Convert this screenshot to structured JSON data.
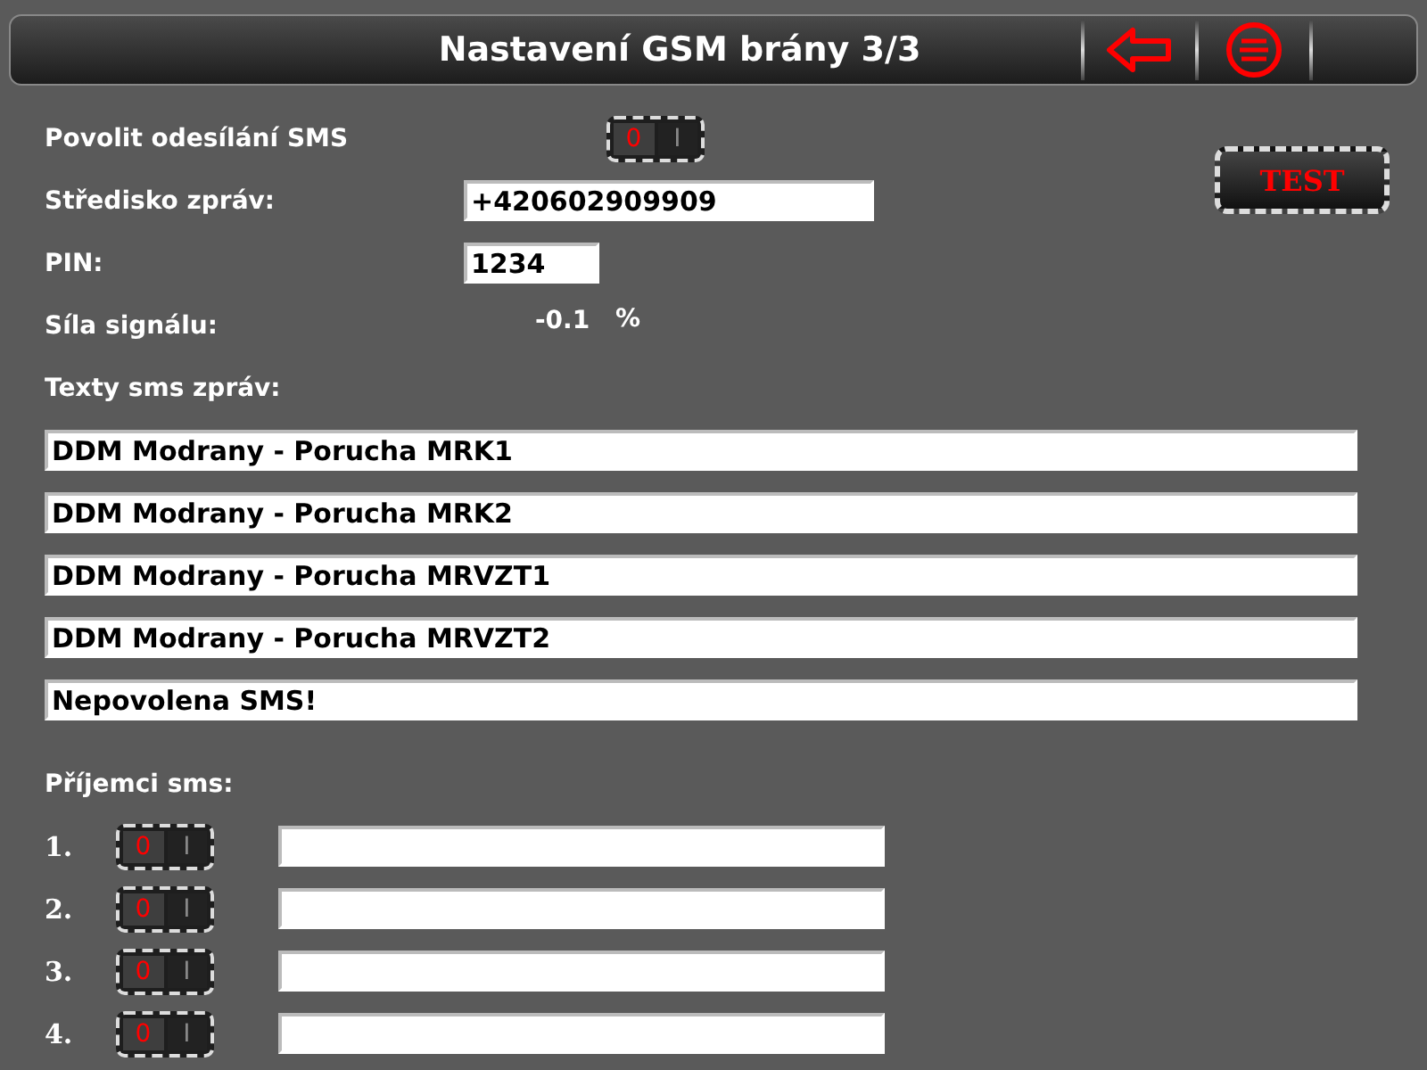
{
  "header": {
    "title": "Nastavení GSM brány 3/3"
  },
  "send_sms": {
    "label": "Povolit odesílání SMS",
    "toggle": {
      "off_label": "0",
      "on_label": "I",
      "on": false
    }
  },
  "test_button": "TEST",
  "message_center": {
    "label": "Středisko zpráv:",
    "value": "+420602909909"
  },
  "pin": {
    "label": "PIN:",
    "value": "1234"
  },
  "signal": {
    "label": "Síla signálu:",
    "value": "-0.1",
    "unit": "%"
  },
  "messages": {
    "label": "Texty sms zpráv:",
    "items": [
      {
        "value": "DDM Modrany - Porucha MRK1"
      },
      {
        "value": "DDM Modrany - Porucha MRK2"
      },
      {
        "value": "DDM Modrany - Porucha MRVZT1"
      },
      {
        "value": "DDM Modrany - Porucha MRVZT2"
      },
      {
        "value": "Nepovolena SMS!"
      }
    ]
  },
  "recipients": {
    "label": "Příjemci sms:",
    "items": [
      {
        "number": "1.",
        "toggle": {
          "off_label": "0",
          "on_label": "I",
          "on": false
        }
      },
      {
        "number": "2.",
        "toggle": {
          "off_label": "0",
          "on_label": "I",
          "on": false
        }
      },
      {
        "number": "3.",
        "toggle": {
          "off_label": "0",
          "on_label": "I",
          "on": false
        }
      },
      {
        "number": "4.",
        "toggle": {
          "off_label": "0",
          "on_label": "I",
          "on": false
        }
      }
    ]
  }
}
